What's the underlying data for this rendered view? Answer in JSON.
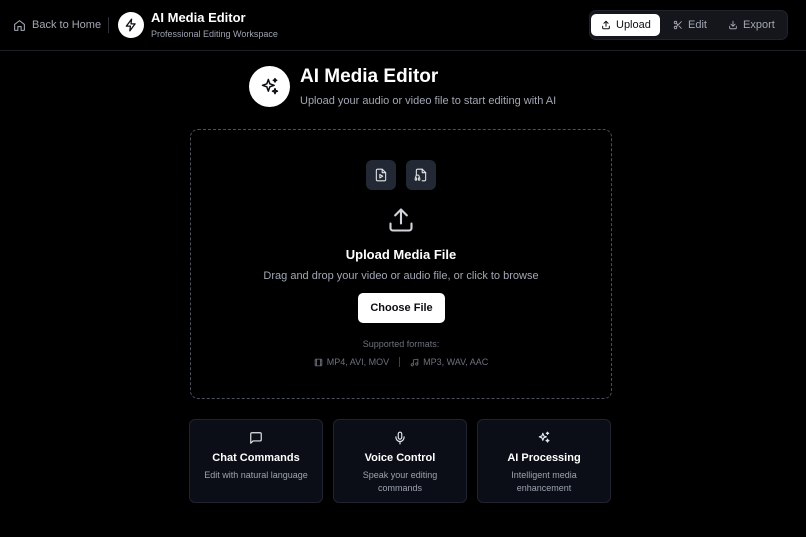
{
  "header": {
    "back_label": "Back to Home",
    "app_title": "AI Media Editor",
    "app_subtitle": "Professional Editing Workspace",
    "tabs": [
      {
        "label": "Upload",
        "icon": "upload-icon",
        "active": true
      },
      {
        "label": "Edit",
        "icon": "scissors-icon",
        "active": false
      },
      {
        "label": "Export",
        "icon": "download-icon",
        "active": false
      }
    ]
  },
  "hero": {
    "title": "AI Media Editor",
    "subtitle": "Upload your audio or video file to start editing with AI",
    "icon": "sparkles-icon"
  },
  "dropzone": {
    "title": "Upload Media File",
    "subtitle": "Drag and drop your video or audio file, or click to browse",
    "button_label": "Choose File",
    "formats_label": "Supported formats:",
    "video_formats": "MP4, AVI, MOV",
    "audio_formats": "MP3, WAV, AAC"
  },
  "features": [
    {
      "title": "Chat Commands",
      "description": "Edit with natural language",
      "icon": "chat-icon"
    },
    {
      "title": "Voice Control",
      "description": "Speak your editing commands",
      "icon": "microphone-icon"
    },
    {
      "title": "AI Processing",
      "description": "Intelligent media enhancement",
      "icon": "sparkles-icon"
    }
  ],
  "colors": {
    "background": "#000000",
    "card": "#0b0e16",
    "accent": "#ffffff",
    "muted_text": "#a1a7b3"
  }
}
